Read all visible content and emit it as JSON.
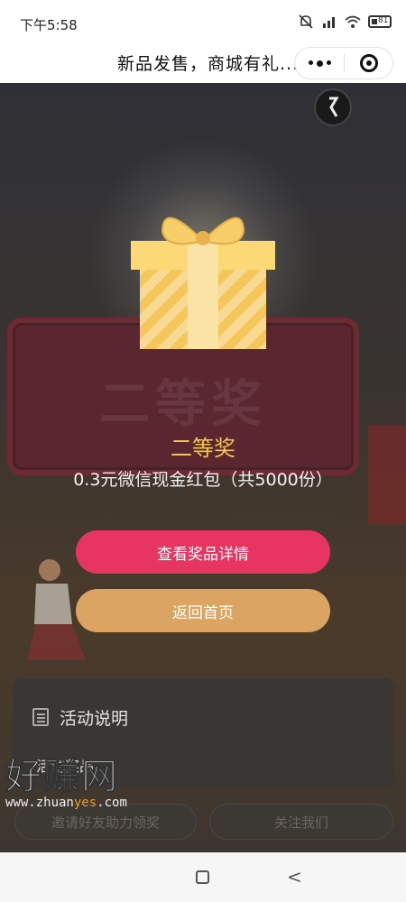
{
  "status_bar": {
    "time": "下午5:58",
    "battery": "81"
  },
  "header": {
    "title": "新品发售，商城有礼..."
  },
  "board": {
    "text": "二等奖"
  },
  "prize": {
    "level": "二等奖",
    "description": "0.3元微信现金红包（共5000份）"
  },
  "buttons": {
    "detail_label": "查看奖品详情",
    "home_label": "返回首页"
  },
  "rules": {
    "title": "活动说明",
    "subtitle": "活动奖品"
  },
  "bottom": {
    "left_label": "邀请好友助力领奖",
    "right_label": "关注我们"
  },
  "watermark": {
    "big": "好赚网",
    "url_prefix": "www.zhuan",
    "url_highlight": "yes",
    "url_suffix": ".com"
  },
  "colors": {
    "accent_pink": "#e83461",
    "accent_gold": "#dba462",
    "prize_yellow": "#f3c74a"
  }
}
